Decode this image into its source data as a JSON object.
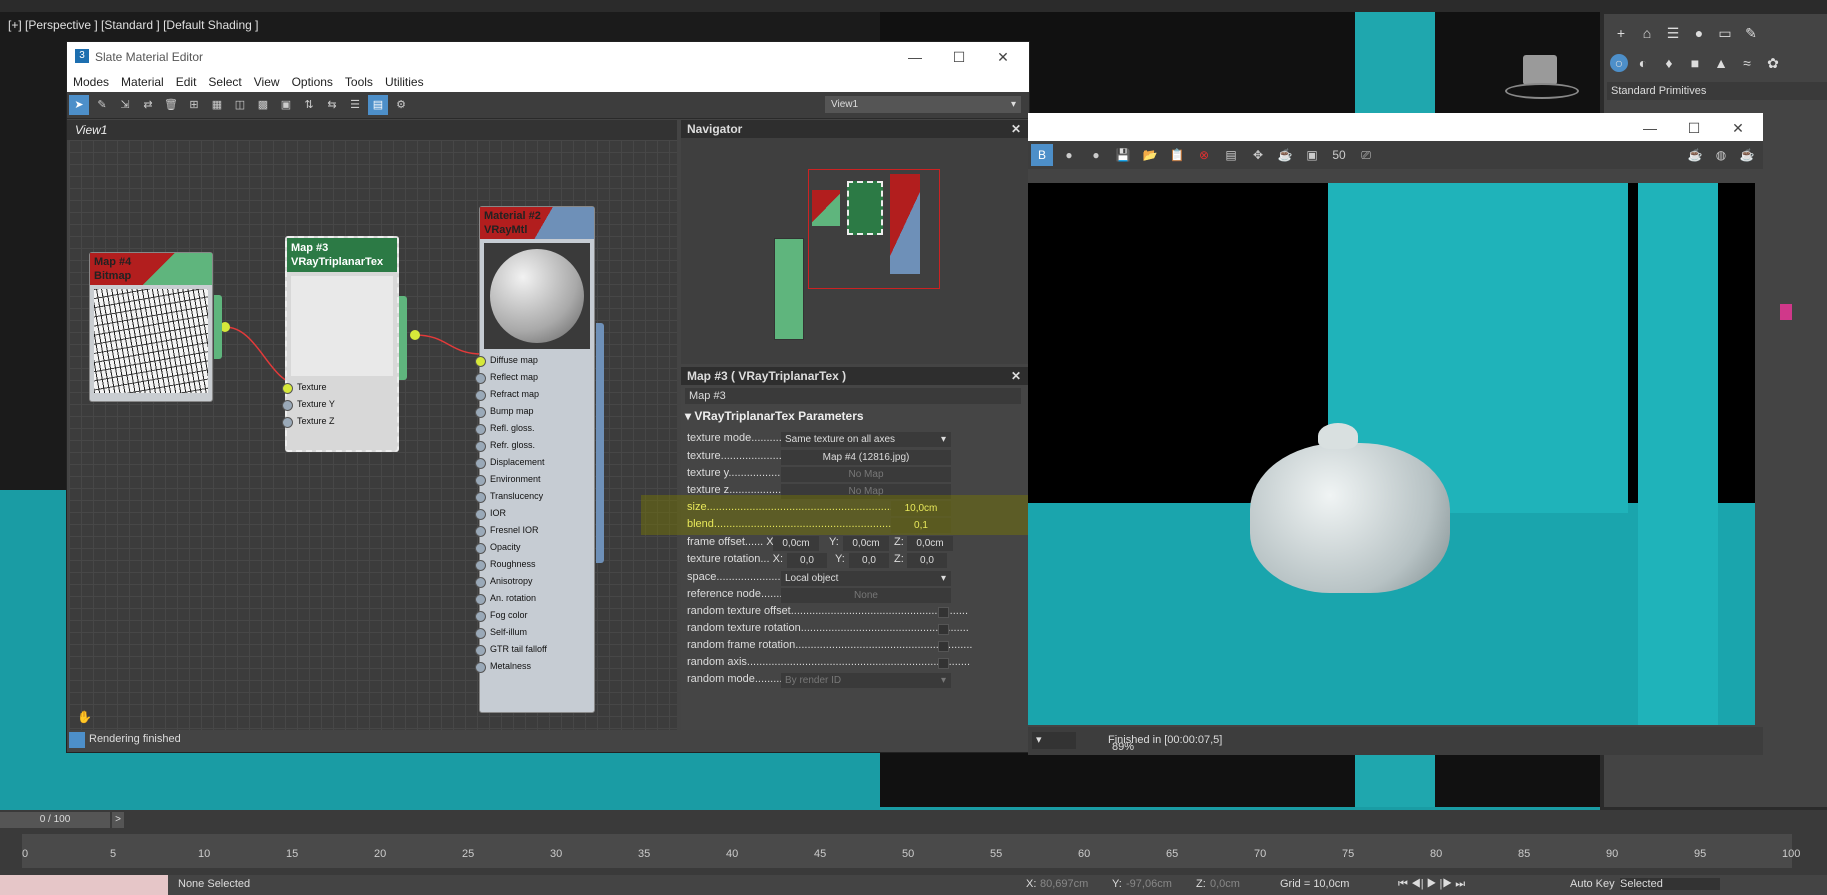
{
  "viewport": {
    "label": "[+] [Perspective ] [Standard ] [Default Shading ]"
  },
  "command_panel": {
    "dropdown": "Standard Primitives",
    "icons": [
      "plus-icon",
      "modify-icon",
      "hierarchy-icon",
      "motion-icon",
      "display-icon",
      "utilities-icon"
    ]
  },
  "slate": {
    "title": "Slate Material Editor",
    "menu": [
      "Modes",
      "Material",
      "Edit",
      "Select",
      "View",
      "Options",
      "Tools",
      "Utilities"
    ],
    "view_dropdown": "View1",
    "view_tab": "View1",
    "status": "Rendering finished",
    "nodes": {
      "bitmap": {
        "title1": "Map #4",
        "title2": "Bitmap"
      },
      "triplanar": {
        "title1": "Map #3",
        "title2": "VRayTriplanarTex",
        "slots": [
          "Texture",
          "Texture Y",
          "Texture Z"
        ]
      },
      "material": {
        "title1": "Material #2",
        "title2": "VRayMtl",
        "slots": [
          "Diffuse map",
          "Reflect map",
          "Refract map",
          "Bump map",
          "Refl. gloss.",
          "Refr. gloss.",
          "Displacement",
          "Environment",
          "Translucency",
          "IOR",
          "Fresnel IOR",
          "Opacity",
          "Roughness",
          "Anisotropy",
          "An. rotation",
          "Fog color",
          "Self-illum",
          "GTR tail falloff",
          "Metalness"
        ]
      }
    }
  },
  "navigator": {
    "title": "Navigator"
  },
  "params": {
    "header": "Map #3  ( VRayTriplanarTex )",
    "name_field": "Map #3",
    "rollout": "VRayTriplanarTex Parameters",
    "texture_mode_label": "texture mode",
    "texture_mode_value": "Same texture on all axes",
    "texture_label": "texture",
    "texture_value": "Map #4 (12816.jpg)",
    "texture_y_label": "texture y",
    "texture_y_value": "No Map",
    "texture_z_label": "texture z",
    "texture_z_value": "No Map",
    "size_label": "size",
    "size_value": "10,0cm",
    "blend_label": "blend",
    "blend_value": "0,1",
    "frame_offset_label": "frame offset",
    "frame_offset": {
      "x": "0,0cm",
      "y": "0,0cm",
      "z": "0,0cm"
    },
    "texture_rotation_label": "texture rotation",
    "texture_rotation": {
      "x": "0,0",
      "y": "0,0",
      "z": "0,0"
    },
    "space_label": "space",
    "space_value": "Local object",
    "reference_node_label": "reference node",
    "reference_node_value": "None",
    "random_texture_offset": "random texture offset",
    "random_texture_rotation": "random texture rotation",
    "random_frame_rotation": "random frame rotation",
    "random_axis": "random axis",
    "random_mode_label": "random mode",
    "random_mode_value": "By render ID",
    "axis_x": "X:",
    "axis_y": "Y:",
    "axis_z": "Z:"
  },
  "frame_buffer": {
    "zoom": "89%",
    "status": "Finished in [00:00:07,5]"
  },
  "timeline": {
    "slider": "0 / 100",
    "ticks": [
      "0",
      "5",
      "10",
      "15",
      "20",
      "25",
      "30",
      "35",
      "40",
      "45",
      "50",
      "55",
      "60",
      "65",
      "70",
      "75",
      "80",
      "85",
      "90",
      "95",
      "100"
    ]
  },
  "bottom": {
    "selection": "None Selected",
    "x": "80,697cm",
    "y": "-97,06cm",
    "z": "0,0cm",
    "grid": "Grid = 10,0cm",
    "autokey": "Auto Key",
    "selected": "Selected",
    "x_label": "X:",
    "y_label": "Y:",
    "z_label": "Z:"
  }
}
